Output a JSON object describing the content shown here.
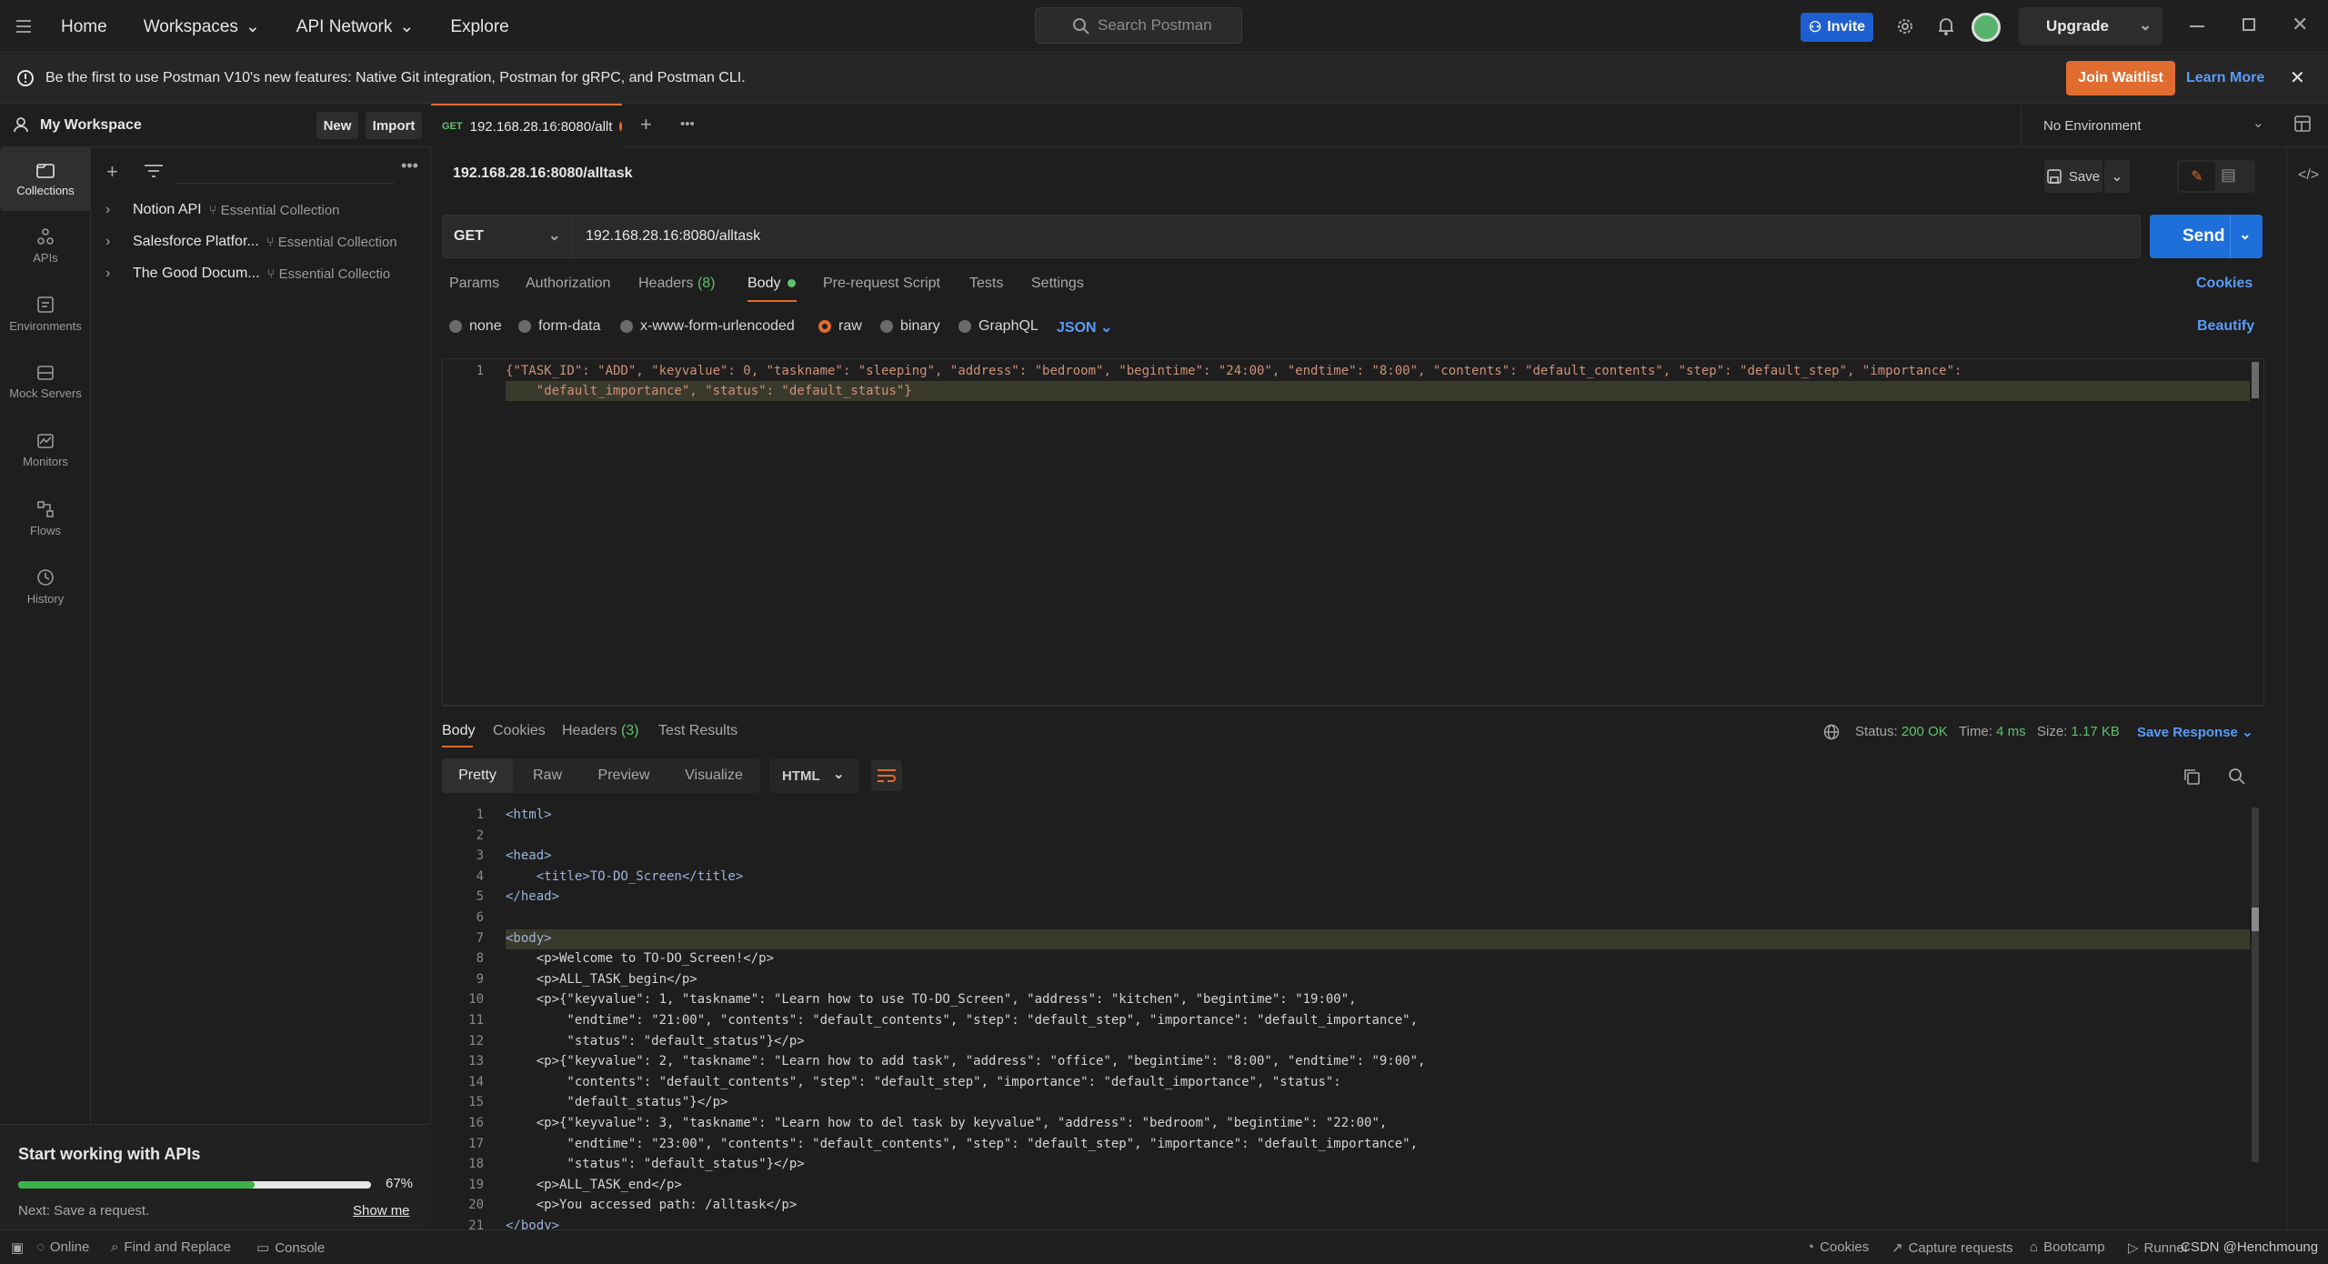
{
  "topbar": {
    "home": "Home",
    "workspaces": "Workspaces",
    "api_network": "API Network",
    "explore": "Explore",
    "search_placeholder": "Search Postman",
    "invite": "Invite",
    "upgrade": "Upgrade"
  },
  "banner": {
    "text": "Be the first to use Postman V10's new features: Native Git integration, Postman for gRPC, and Postman CLI.",
    "join": "Join Waitlist",
    "learn": "Learn More"
  },
  "workspace": {
    "name": "My Workspace",
    "new": "New",
    "import": "Import"
  },
  "rail": [
    {
      "label": "Collections",
      "icon": "collections-icon",
      "active": true
    },
    {
      "label": "APIs",
      "icon": "apis-icon"
    },
    {
      "label": "Environments",
      "icon": "environments-icon"
    },
    {
      "label": "Mock Servers",
      "icon": "mock-servers-icon"
    },
    {
      "label": "Monitors",
      "icon": "monitors-icon"
    },
    {
      "label": "Flows",
      "icon": "flows-icon"
    },
    {
      "label": "History",
      "icon": "history-icon"
    }
  ],
  "collections": [
    {
      "name": "Notion API",
      "sub": "Essential Collection"
    },
    {
      "name": "Salesforce Platfor...",
      "sub": "Essential Collection"
    },
    {
      "name": "The Good Docum...",
      "sub": "Essential Collectio"
    }
  ],
  "start_card": {
    "title": "Start working with APIs",
    "percent": "67%",
    "progress": 0.67,
    "next": "Next: Save a request.",
    "show": "Show me"
  },
  "tab": {
    "method": "GET",
    "title": "192.168.28.16:8080/allt"
  },
  "environment": "No Environment",
  "request": {
    "title": "192.168.28.16:8080/alltask",
    "save": "Save",
    "method": "GET",
    "url": "192.168.28.16:8080/alltask",
    "send": "Send",
    "tabs": [
      "Params",
      "Authorization",
      "Headers",
      "Body",
      "Pre-request Script",
      "Tests",
      "Settings"
    ],
    "headers_count": "(8)",
    "cookies": "Cookies",
    "body_types": [
      "none",
      "form-data",
      "x-www-form-urlencoded",
      "raw",
      "binary",
      "GraphQL"
    ],
    "format": "JSON",
    "beautify": "Beautify",
    "body_lines": [
      "{\"TASK_ID\": \"ADD\", \"keyvalue\": 0, \"taskname\": \"sleeping\", \"address\": \"bedroom\", \"begintime\": \"24:00\", \"endtime\": \"8:00\", \"contents\": \"default_contents\", \"step\": \"default_step\", \"importance\":",
      "    \"default_importance\", \"status\": \"default_status\"}"
    ]
  },
  "response": {
    "tabs": [
      "Body",
      "Cookies",
      "Headers",
      "Test Results"
    ],
    "headers_count": "(3)",
    "status_label": "Status:",
    "status": "200 OK",
    "time_label": "Time:",
    "time": "4 ms",
    "size_label": "Size:",
    "size": "1.17 KB",
    "save_response": "Save Response",
    "views": [
      "Pretty",
      "Raw",
      "Preview",
      "Visualize"
    ],
    "format": "HTML",
    "lines": [
      "<html>",
      "",
      "<head>",
      "    <title>TO-DO_Screen</title>",
      "</head>",
      "",
      "<body>",
      "    <p>Welcome to TO-DO_Screen!</p>",
      "    <p>ALL_TASK_begin</p>",
      "    <p>{\"keyvalue\": 1, \"taskname\": \"Learn how to use TO-DO_Screen\", \"address\": \"kitchen\", \"begintime\": \"19:00\",",
      "        \"endtime\": \"21:00\", \"contents\": \"default_contents\", \"step\": \"default_step\", \"importance\": \"default_importance\",",
      "        \"status\": \"default_status\"}</p>",
      "    <p>{\"keyvalue\": 2, \"taskname\": \"Learn how to add task\", \"address\": \"office\", \"begintime\": \"8:00\", \"endtime\": \"9:00\",",
      "        \"contents\": \"default_contents\", \"step\": \"default_step\", \"importance\": \"default_importance\", \"status\":",
      "        \"default_status\"}</p>",
      "    <p>{\"keyvalue\": 3, \"taskname\": \"Learn how to del task by keyvalue\", \"address\": \"bedroom\", \"begintime\": \"22:00\",",
      "        \"endtime\": \"23:00\", \"contents\": \"default_contents\", \"step\": \"default_step\", \"importance\": \"default_importance\",",
      "        \"status\": \"default_status\"}</p>",
      "    <p>ALL_TASK_end</p>",
      "    <p>You accessed path: /alltask</p>",
      "</body>"
    ]
  },
  "statusbar": {
    "online": "Online",
    "find": "Find and Replace",
    "console": "Console",
    "cookies": "Cookies",
    "capture": "Capture requests",
    "bootcamp": "Bootcamp",
    "runner": "Runner",
    "watermark": "CSDN @Henchmoung"
  },
  "colors": {
    "accent": "#e06c2f",
    "send": "#1e6fd9",
    "invite": "#1d5fd1",
    "link": "#5a9cf8",
    "ok": "#5ec26a"
  }
}
